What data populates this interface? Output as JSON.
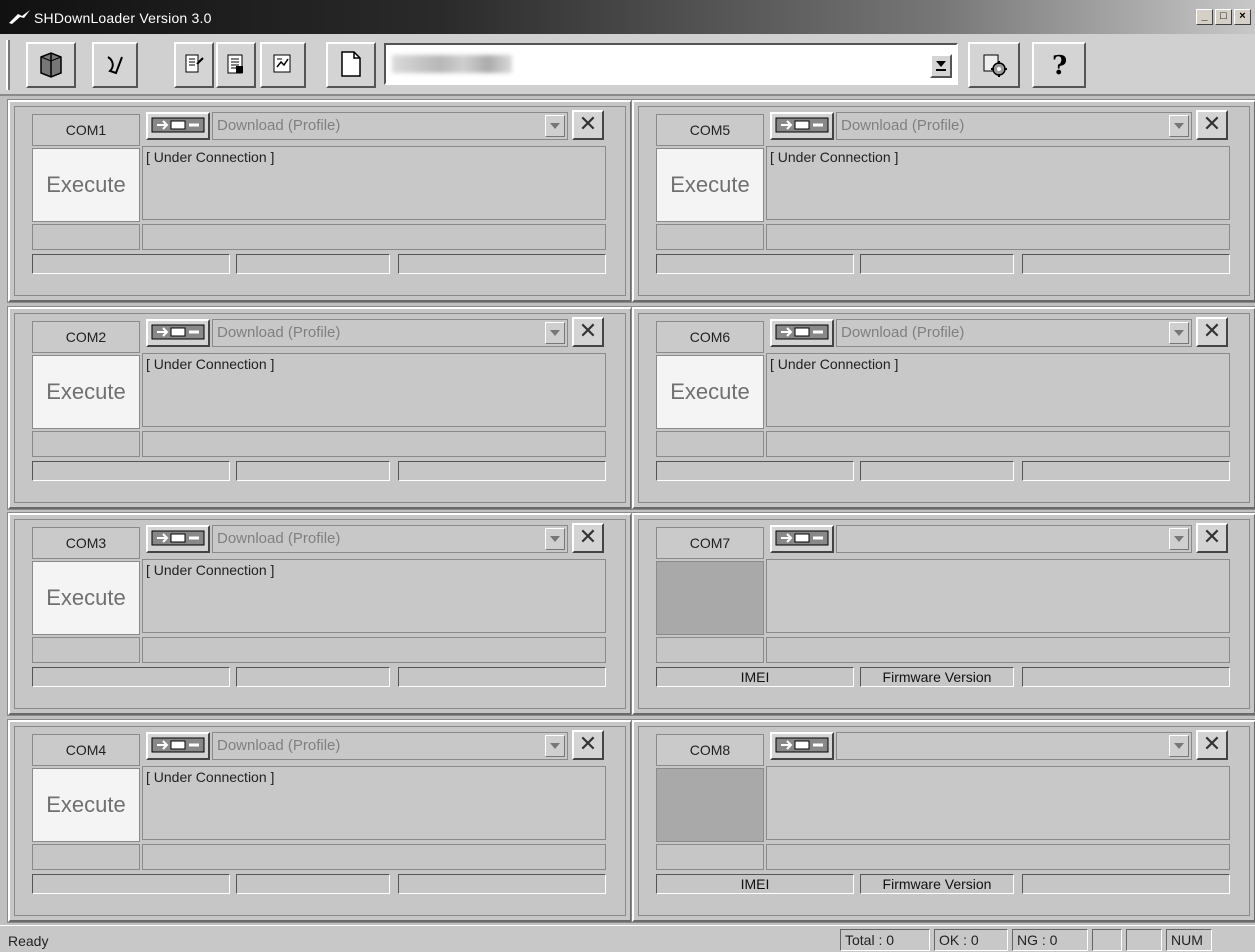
{
  "window": {
    "title": "SHDownLoader Version 3.0",
    "controls": [
      "_",
      "□",
      "×"
    ]
  },
  "toolbar": {
    "buttons": [
      {
        "name": "open-book-icon"
      },
      {
        "name": "connect-icon"
      },
      {
        "name": "document-edit-icon"
      },
      {
        "name": "checklist-icon"
      },
      {
        "name": "export-icon"
      },
      {
        "name": "new-file-icon"
      }
    ],
    "profile_value": "",
    "settings_icon": "settings-icon",
    "help_icon": "help-icon"
  },
  "ports": [
    {
      "label": "COM1",
      "mode": "Download (Profile)",
      "execute": "Execute",
      "status": "[ Under Connection ]",
      "imei": "",
      "firmware": ""
    },
    {
      "label": "COM2",
      "mode": "Download (Profile)",
      "execute": "Execute",
      "status": "[ Under Connection ]",
      "imei": "",
      "firmware": ""
    },
    {
      "label": "COM3",
      "mode": "Download (Profile)",
      "execute": "Execute",
      "status": "[ Under Connection ]",
      "imei": "",
      "firmware": ""
    },
    {
      "label": "COM4",
      "mode": "Download (Profile)",
      "execute": "Execute",
      "status": "[ Under Connection ]",
      "imei": "",
      "firmware": ""
    },
    {
      "label": "COM5",
      "mode": "Download (Profile)",
      "execute": "Execute",
      "status": "[ Under Connection ]",
      "imei": "",
      "firmware": ""
    },
    {
      "label": "COM6",
      "mode": "Download (Profile)",
      "execute": "Execute",
      "status": "[ Under Connection ]",
      "imei": "",
      "firmware": ""
    },
    {
      "label": "COM7",
      "mode": "",
      "execute": "",
      "status": "",
      "imei": "IMEI",
      "firmware": "Firmware Version"
    },
    {
      "label": "COM8",
      "mode": "",
      "execute": "",
      "status": "",
      "imei": "IMEI",
      "firmware": "Firmware Version"
    }
  ],
  "statusbar": {
    "ready": "Ready",
    "total": "Total : 0",
    "ok": "OK : 0",
    "ng": "NG : 0",
    "num": "NUM"
  }
}
